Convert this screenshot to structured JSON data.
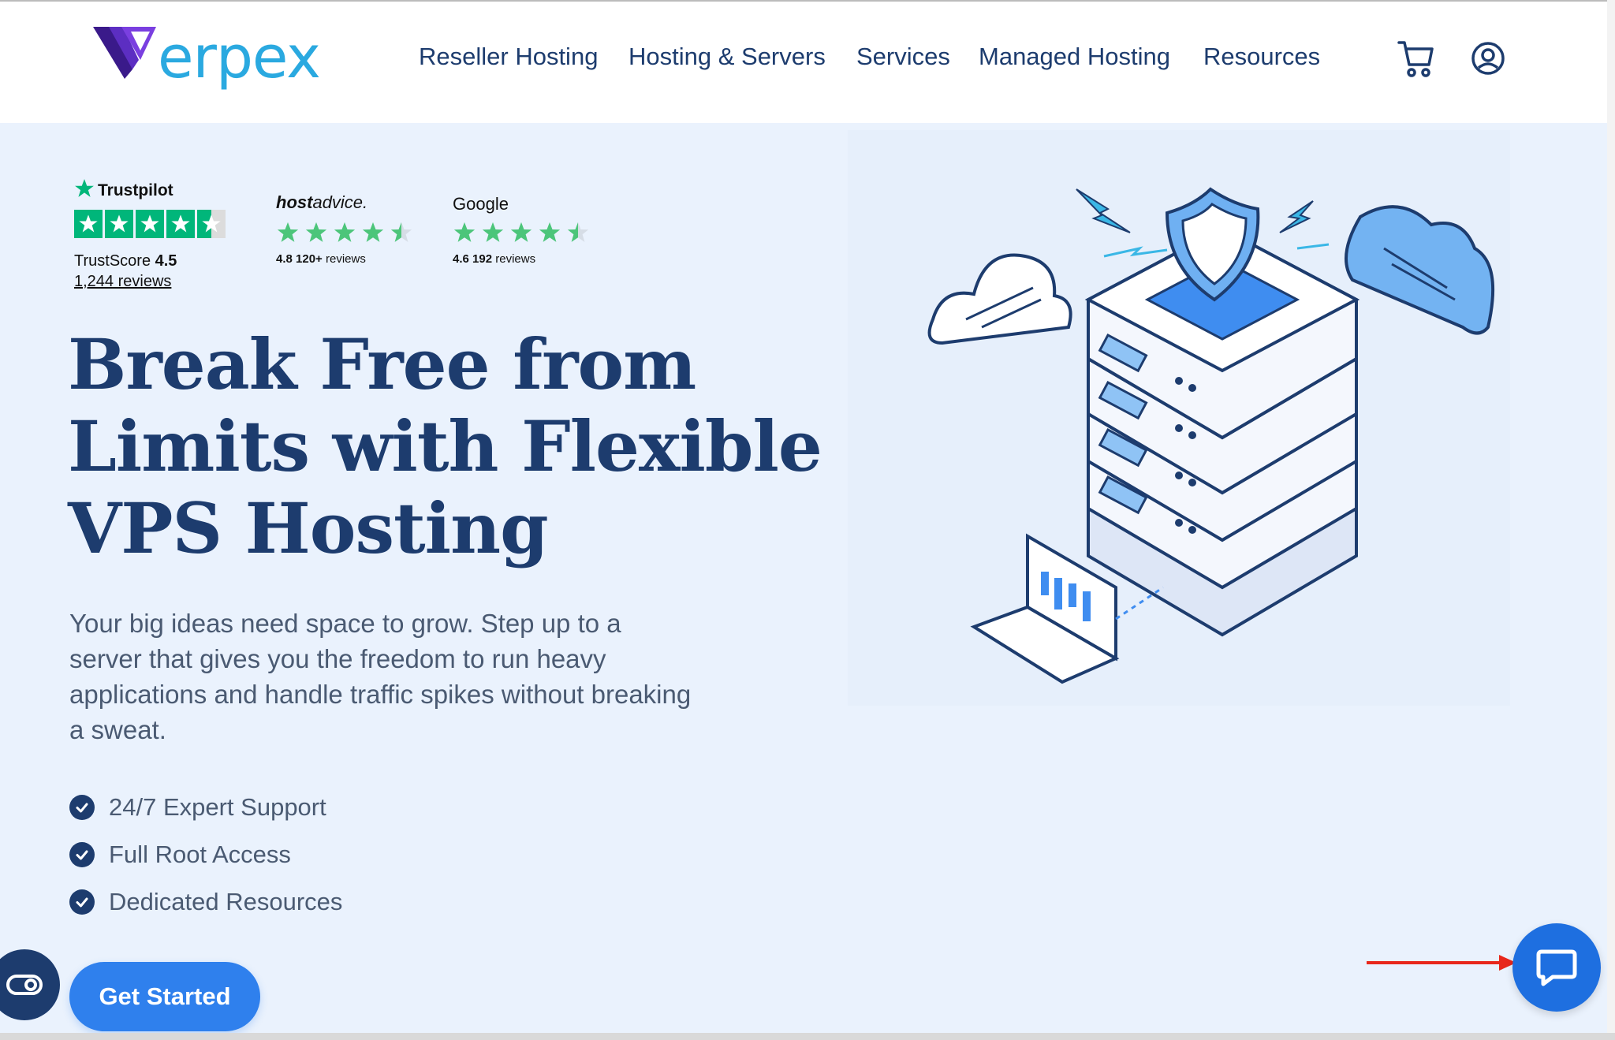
{
  "brand": {
    "logo_text": "erpex",
    "accent_color": "#2aa9e0",
    "primary_color": "#1d3c6e"
  },
  "nav": {
    "items": [
      {
        "label": "Reseller Hosting"
      },
      {
        "label": "Hosting & Servers"
      },
      {
        "label": "Services"
      },
      {
        "label": "Managed Hosting"
      },
      {
        "label": "Resources"
      }
    ],
    "cart_icon": "cart-icon",
    "account_icon": "user-circle-icon"
  },
  "ratings": {
    "trustpilot": {
      "title": "Trustpilot",
      "score_label": "TrustScore",
      "score": "4.5",
      "reviews": "1,244 reviews",
      "stars": 4.5
    },
    "hostadvice": {
      "title_bold": "host",
      "title_light": "advice.",
      "caption_value": "4.8",
      "caption_count": "120+",
      "caption_suffix": "reviews",
      "stars": 4.5
    },
    "google": {
      "title": "Google",
      "caption_value": "4.6",
      "caption_count": "192",
      "caption_suffix": "reviews",
      "stars": 4.5
    }
  },
  "hero": {
    "headline_lines": [
      "Break Free from",
      "Limits with Flexible",
      "VPS Hosting"
    ],
    "subtext": "Your big ideas need space to grow. Step up to a server that gives you the freedom to run heavy applications and handle traffic spikes without breaking a sweat.",
    "features": [
      "24/7 Expert Support",
      "Full Root Access",
      "Dedicated Resources"
    ],
    "cta_label": "Get Started"
  },
  "widgets": {
    "accessibility_icon": "accessibility-toggle-icon",
    "chat_icon": "chat-bubble-icon",
    "annotation_color": "#e8271b"
  }
}
